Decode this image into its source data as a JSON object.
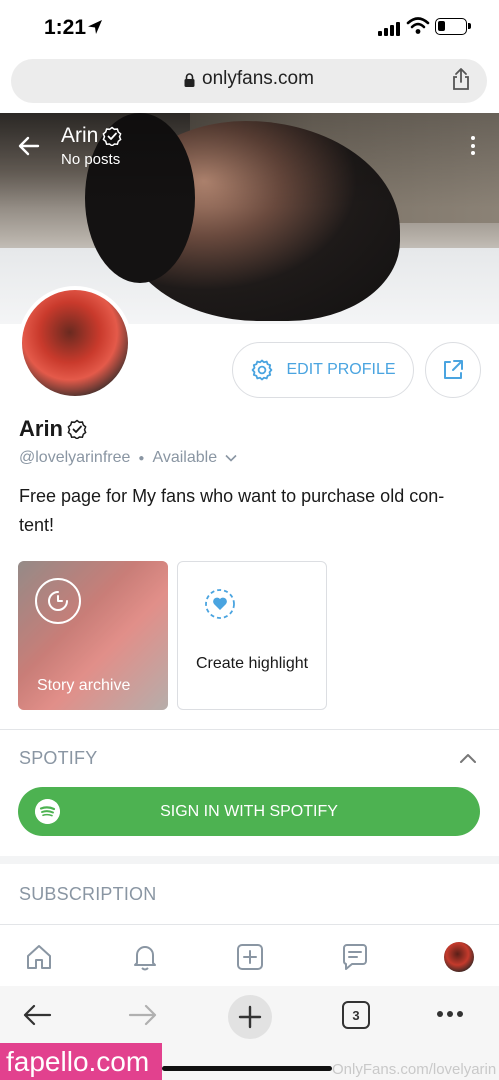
{
  "status": {
    "time": "1:21"
  },
  "browser": {
    "url": "onlyfans.com"
  },
  "cover": {
    "name": "Arin",
    "subtitle": "No posts"
  },
  "profile": {
    "name": "Arin",
    "handle": "@lovelyarinfree",
    "availability": "Available",
    "bio": "Free page for My fans who want to purchase old con-tent!",
    "edit_label": "EDIT PROFILE"
  },
  "highlights": {
    "archive_label": "Story archive",
    "create_label": "Create highlight"
  },
  "spotify": {
    "section_title": "SPOTIFY",
    "button_label": "SIGN IN WITH SPOTIFY",
    "brand_color": "#4db251"
  },
  "subscription": {
    "section_title": "SUBSCRIPTION"
  },
  "bottom_nav": {
    "items": [
      "home-icon",
      "bell-icon",
      "plus-square-icon",
      "messages-icon",
      "avatar"
    ]
  },
  "browser_bar": {
    "tab_count": "3"
  },
  "watermark": {
    "left": "fapello.com",
    "right": "OnlyFans.com/lovelyarin"
  },
  "colors": {
    "accent": "#4aa4e0",
    "muted": "#8a96a3"
  }
}
